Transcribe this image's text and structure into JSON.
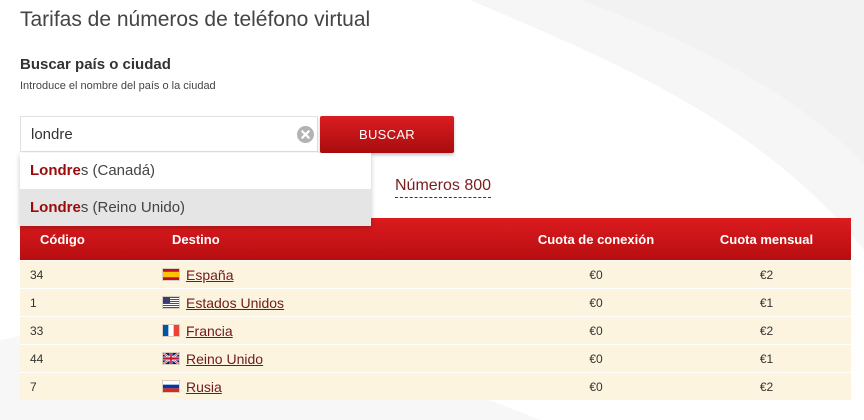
{
  "page": {
    "title": "Tarifas de números de teléfono virtual"
  },
  "search": {
    "heading": "Buscar país o ciudad",
    "hint": "Introduce el nombre del país o la ciudad",
    "value": "londre",
    "clear_icon": "clear-icon",
    "button_label": "BUSCAR",
    "suggestions": [
      {
        "match": "Londre",
        "rest": "s (Canadá)",
        "highlighted": false
      },
      {
        "match": "Londre",
        "rest": "s (Reino Unido)",
        "highlighted": true
      }
    ]
  },
  "links": {
    "numbers_800": "Números 800"
  },
  "table": {
    "headers": {
      "code": "Código",
      "destination": "Destino",
      "connection_fee": "Cuota de conexión",
      "monthly_fee": "Cuota mensual"
    },
    "rows": [
      {
        "code": "34",
        "flag_icon": "spain-flag-icon",
        "destination": "España",
        "connection_fee": "€0",
        "monthly_fee": "€2"
      },
      {
        "code": "1",
        "flag_icon": "usa-flag-icon",
        "destination": "Estados Unidos",
        "connection_fee": "€0",
        "monthly_fee": "€1"
      },
      {
        "code": "33",
        "flag_icon": "france-flag-icon",
        "destination": "Francia",
        "connection_fee": "€0",
        "monthly_fee": "€2"
      },
      {
        "code": "44",
        "flag_icon": "uk-flag-icon",
        "destination": "Reino Unido",
        "connection_fee": "€0",
        "monthly_fee": "€1"
      },
      {
        "code": "7",
        "flag_icon": "russia-flag-icon",
        "destination": "Rusia",
        "connection_fee": "€0",
        "monthly_fee": "€2"
      }
    ]
  },
  "colors": {
    "accent_red": "#c8151a",
    "match_text": "#9b0b0b",
    "link": "#7a1d1d",
    "row_background": "#fcf4df",
    "highlight_background": "#e5e5e5"
  }
}
